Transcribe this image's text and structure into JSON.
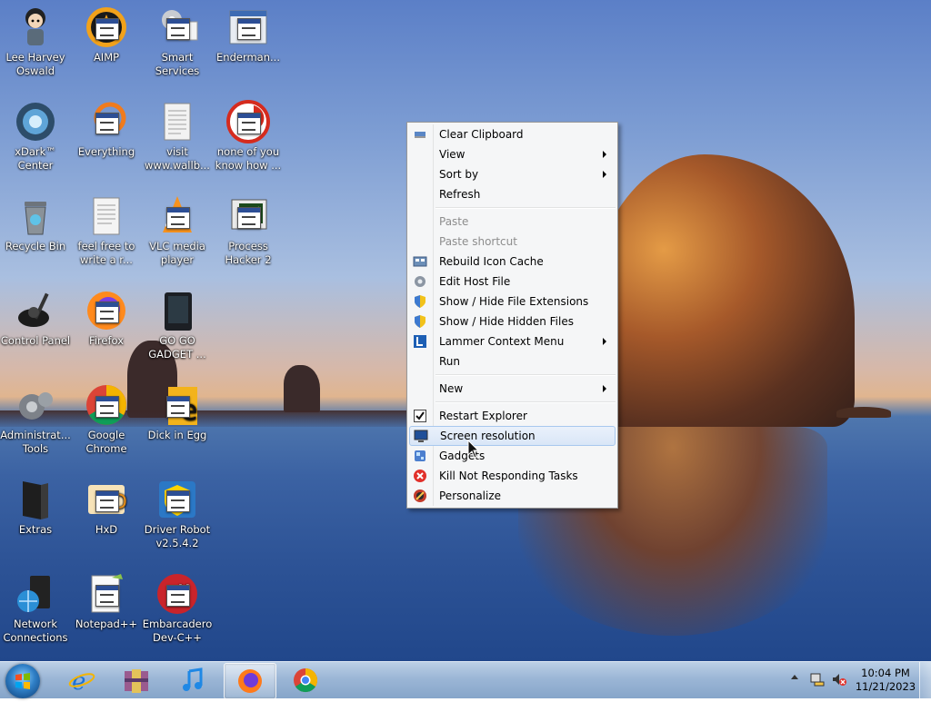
{
  "desktop_icons": [
    {
      "name": "Lee Harvey Oswald",
      "icon": "cartoon-character-icon"
    },
    {
      "name": "AIMP",
      "icon": "aimp-icon"
    },
    {
      "name": "Smart Services",
      "icon": "gears-icon"
    },
    {
      "name": "Enderman...",
      "icon": "window-app-icon"
    },
    {
      "name": "xDark™ Center",
      "icon": "xdark-icon"
    },
    {
      "name": "Everything",
      "icon": "search-app-icon"
    },
    {
      "name": "visit www.wallb...",
      "icon": "document-icon"
    },
    {
      "name": "none of you know how ...",
      "icon": "app-icon"
    },
    {
      "name": "Recycle Bin",
      "icon": "recycle-bin-icon"
    },
    {
      "name": "feel free to write a r...",
      "icon": "text-document-icon"
    },
    {
      "name": "VLC media player",
      "icon": "vlc-icon"
    },
    {
      "name": "Process Hacker 2",
      "icon": "process-hacker-icon"
    },
    {
      "name": "Control Panel",
      "icon": "control-panel-icon"
    },
    {
      "name": "Firefox",
      "icon": "firefox-icon"
    },
    {
      "name": "GO GO GADGET ...",
      "icon": "gadget-icon"
    },
    {
      "name": "Administrat... Tools",
      "icon": "admin-tools-icon"
    },
    {
      "name": "Google Chrome",
      "icon": "chrome-icon"
    },
    {
      "name": "Dick in Egg",
      "icon": "egg-app-icon"
    },
    {
      "name": "Extras",
      "icon": "folder-icon"
    },
    {
      "name": "HxD",
      "icon": "hxd-icon"
    },
    {
      "name": "Driver Robot v2.5.4.2",
      "icon": "shield-installer-icon"
    },
    {
      "name": "Network Connections",
      "icon": "network-icon"
    },
    {
      "name": "Notepad++",
      "icon": "notepad-plus-icon"
    },
    {
      "name": "Embarcadero Dev-C++",
      "icon": "devcpp-icon"
    }
  ],
  "context_menu": {
    "items": [
      {
        "label": "Clear Clipboard",
        "icon": "clipboard-icon",
        "type": "item"
      },
      {
        "label": "View",
        "type": "submenu"
      },
      {
        "label": "Sort by",
        "type": "submenu"
      },
      {
        "label": "Refresh",
        "type": "item"
      },
      {
        "type": "separator"
      },
      {
        "label": "Paste",
        "type": "disabled"
      },
      {
        "label": "Paste shortcut",
        "type": "disabled"
      },
      {
        "label": "Rebuild Icon Cache",
        "icon": "icon-cache-icon",
        "type": "item"
      },
      {
        "label": "Edit Host File",
        "icon": "gear-icon",
        "type": "item"
      },
      {
        "label": "Show / Hide File Extensions",
        "icon": "uac-shield-icon",
        "type": "item"
      },
      {
        "label": "Show / Hide Hidden Files",
        "icon": "uac-shield-icon",
        "type": "item"
      },
      {
        "label": "Lammer Context Menu",
        "icon": "lammer-icon",
        "type": "submenu"
      },
      {
        "label": "Run",
        "type": "item"
      },
      {
        "type": "separator"
      },
      {
        "label": "New",
        "type": "submenu"
      },
      {
        "type": "separator"
      },
      {
        "label": "Restart Explorer",
        "icon": "checkbox-icon",
        "type": "item"
      },
      {
        "label": "Screen resolution",
        "icon": "monitor-icon",
        "type": "hover"
      },
      {
        "label": "Gadgets",
        "icon": "gadgets-icon",
        "type": "item"
      },
      {
        "label": "Kill Not Responding Tasks",
        "icon": "kill-task-icon",
        "type": "item"
      },
      {
        "label": "Personalize",
        "icon": "personalize-icon",
        "type": "item"
      }
    ]
  },
  "taskbar": {
    "pinned": [
      {
        "name": "internet-explorer",
        "icon": "ie-icon"
      },
      {
        "name": "archive-tool",
        "icon": "archive-icon"
      },
      {
        "name": "music-player",
        "icon": "music-note-icon"
      },
      {
        "name": "firefox",
        "icon": "firefox-icon",
        "active": true
      },
      {
        "name": "chrome",
        "icon": "chrome-icon"
      }
    ],
    "tray": {
      "time": "10:04 PM",
      "date": "11/21/2023"
    }
  },
  "colors": {
    "menu_bg": "#f5f6f7",
    "menu_hover": "#d9e6f7",
    "menu_disabled_text": "#8d8d8d",
    "taskbar": "#9bb6d6"
  }
}
